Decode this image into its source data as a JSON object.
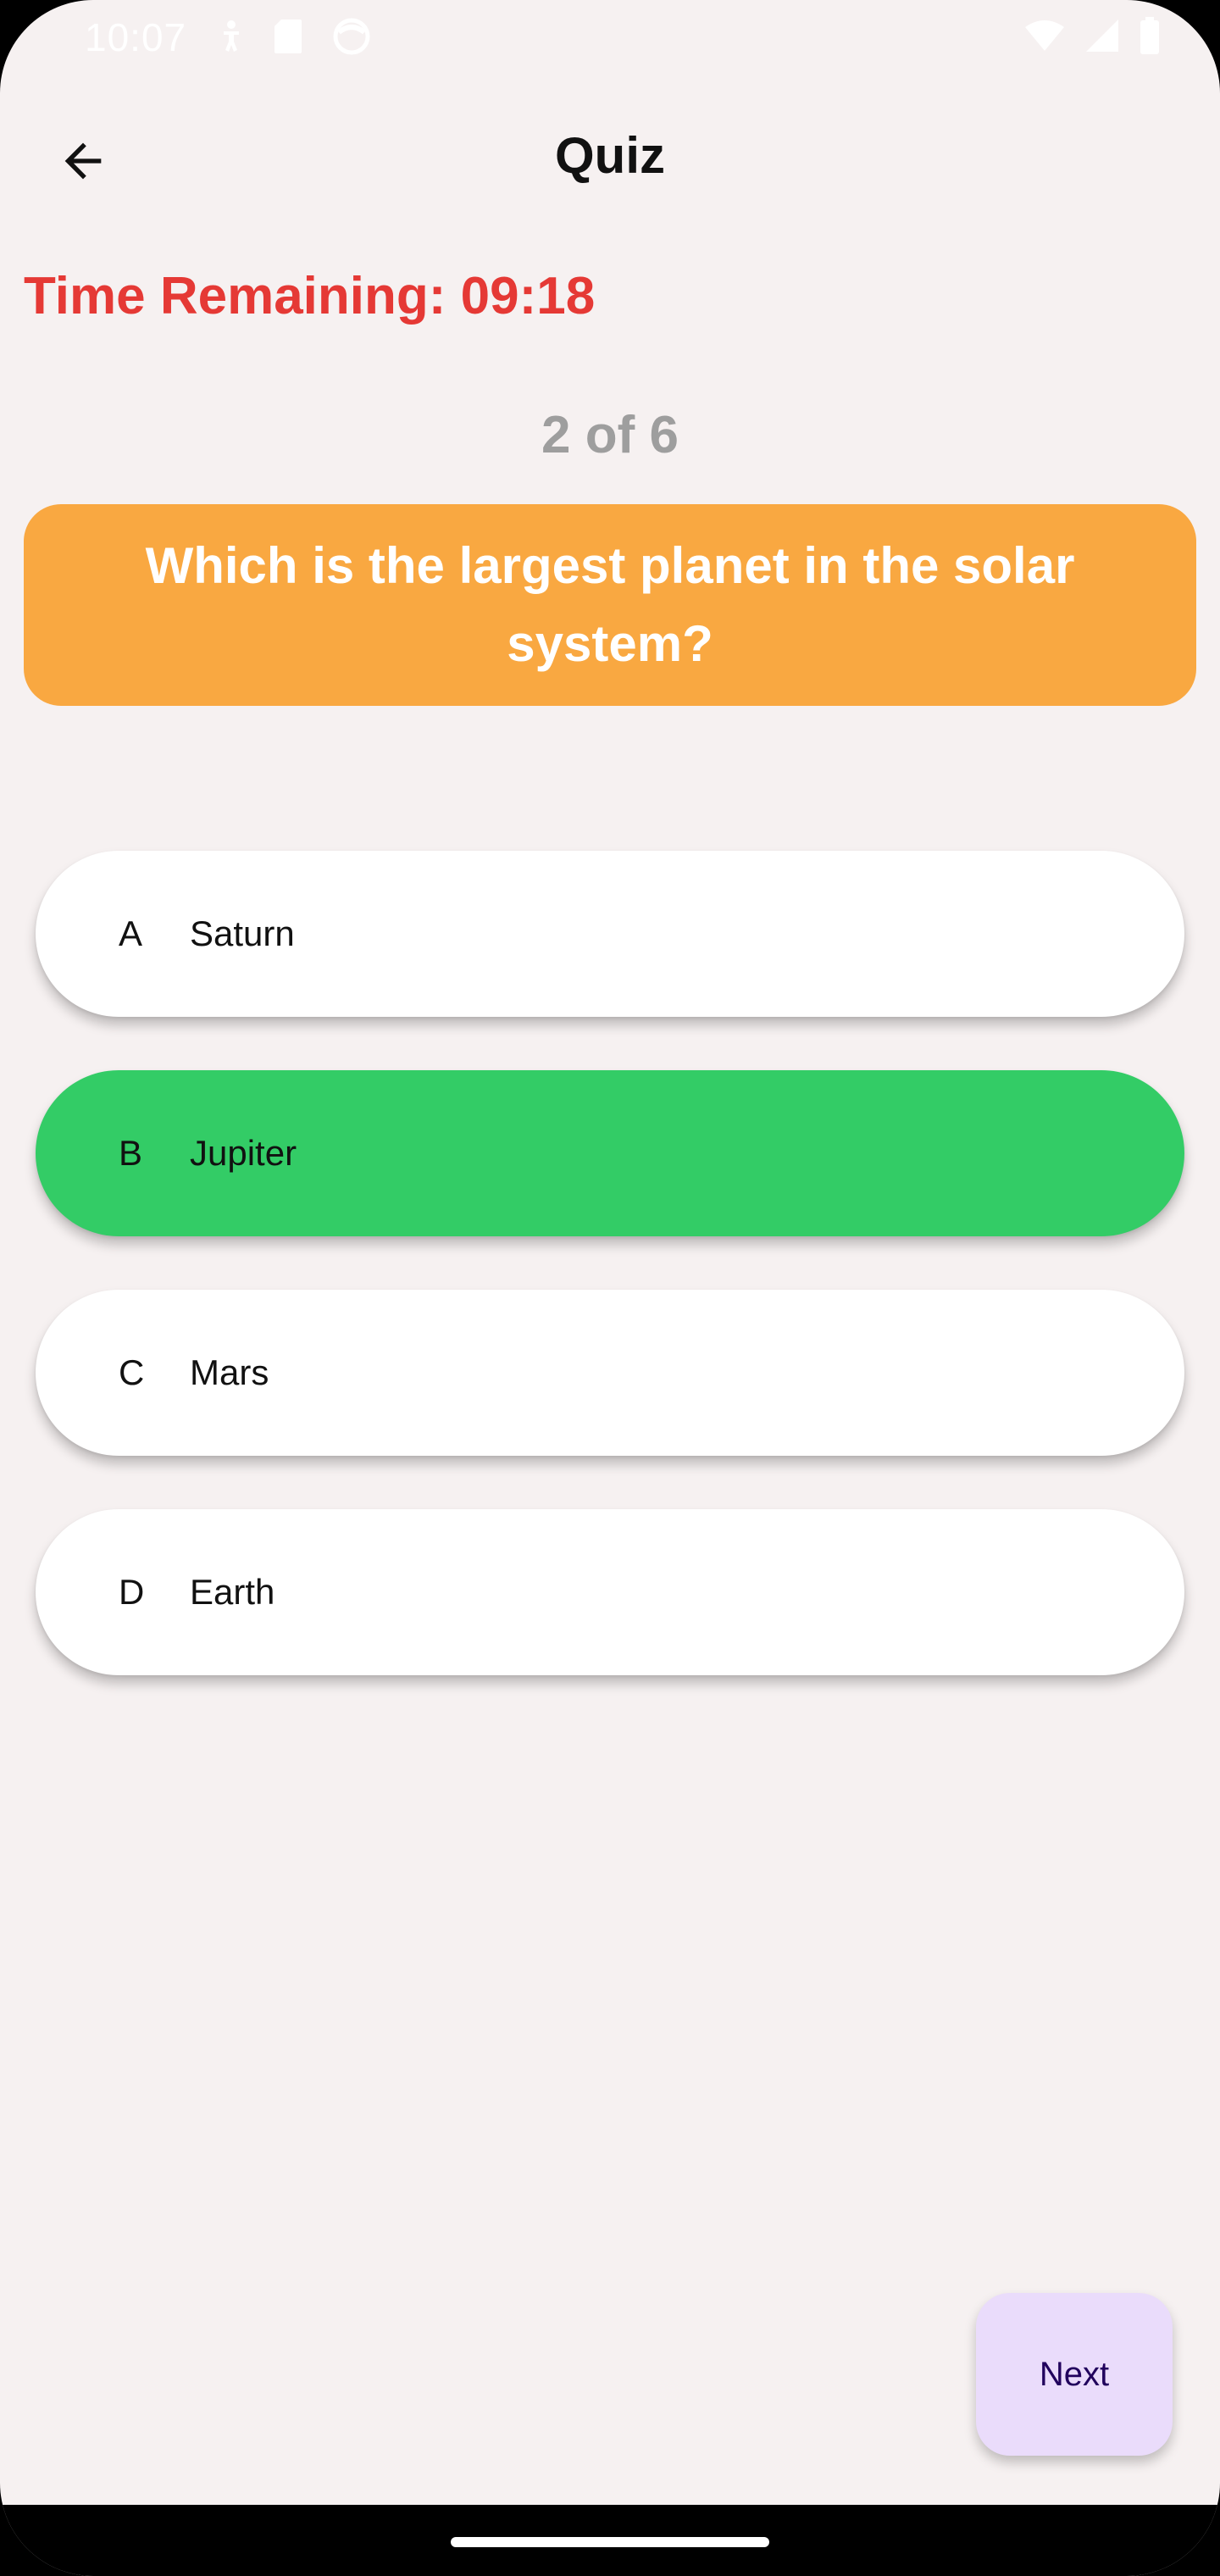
{
  "status_bar": {
    "time": "10:07",
    "left_icons": [
      "accessibility-icon",
      "sd-card-icon",
      "face-icon"
    ],
    "right_icons": [
      "wifi-icon",
      "signal-icon",
      "battery-icon"
    ]
  },
  "app_bar": {
    "title": "Quiz",
    "back_icon": "arrow-back-icon"
  },
  "timer": {
    "text": "Time Remaining: 09:18",
    "color": "#e53935"
  },
  "progress": {
    "text": "2 of 6"
  },
  "question": {
    "text": "Which is the largest planet in the solar system?",
    "background": "#f9a841"
  },
  "options": [
    {
      "letter": "A",
      "text": "Saturn",
      "selected": false
    },
    {
      "letter": "B",
      "text": "Jupiter",
      "selected": true
    },
    {
      "letter": "C",
      "text": "Mars",
      "selected": false
    },
    {
      "letter": "D",
      "text": "Earth",
      "selected": false
    }
  ],
  "colors": {
    "selected_option": "#33cc66",
    "option": "#ffffff",
    "next_button": "#eadcfb"
  },
  "next_button": {
    "label": "Next"
  }
}
